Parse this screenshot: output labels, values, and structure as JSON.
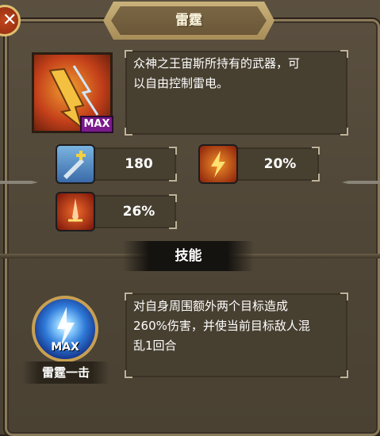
{
  "title": "雷霆",
  "item": {
    "max_badge": "MAX",
    "description": [
      "众神之王宙斯所持有的武器，可",
      "以自由控制雷电。"
    ]
  },
  "stats": [
    {
      "icon": "sword-plus-icon",
      "value": "180"
    },
    {
      "icon": "lightning-burst-icon",
      "value": "20%"
    },
    {
      "icon": "flaming-sword-icon",
      "value": "26%"
    }
  ],
  "skills": {
    "header": "技能",
    "skill": {
      "icon": "lightning-strike-skill-icon",
      "max_label": "MAX",
      "name": "雷霆一击",
      "description": [
        "对自身周围额外两个目标造成",
        "260%伤害，并使当前目标敌人混",
        "乱1回合"
      ]
    }
  },
  "colors": {
    "panel_bg": "#4e4536",
    "box_bg": "#473f30",
    "gold": "#c9b27a",
    "max_badge": "#7a1a8a",
    "close_button": "#c2461c"
  }
}
